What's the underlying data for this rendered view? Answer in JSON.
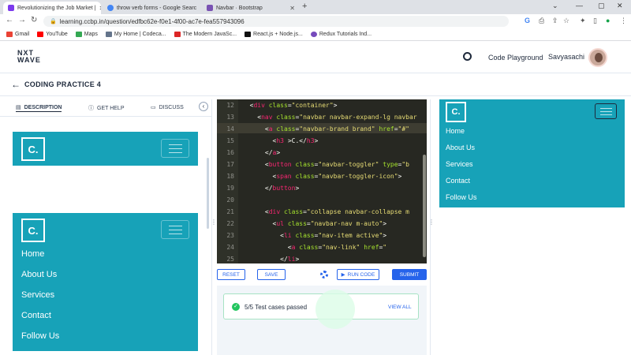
{
  "browser": {
    "tabs": [
      {
        "title": "Revolutionizing the Job Market | ",
        "active": true
      },
      {
        "title": "throw verb forms - Google Searc",
        "active": false
      },
      {
        "title": "Navbar · Bootstrap",
        "active": false
      }
    ],
    "url": "learning.ccbp.in/question/edfbc62e-f0e1-4f00-ac7e-fea557943096",
    "bookmarks": [
      "Gmail",
      "YouTube",
      "Maps",
      "My Home | Codeca...",
      "The Modern JavaSc...",
      "React.js + Node.js...",
      "Redux Tutorials Ind..."
    ]
  },
  "header": {
    "logo_line1": "NXT",
    "logo_line2": "WAVE",
    "playground": "Code Playground",
    "username": "Savyasachi"
  },
  "subheader": {
    "title": "CODING PRACTICE 4"
  },
  "left_tabs": {
    "description": "DESCRIPTION",
    "get_help": "GET HELP",
    "discuss": "DISCUSS"
  },
  "preview": {
    "brand": "C.",
    "links": [
      "Home",
      "About Us",
      "Services",
      "Contact",
      "Follow Us"
    ]
  },
  "editor": {
    "line_numbers": [
      "12",
      "13",
      "14",
      "15",
      "16",
      "17",
      "18",
      "19",
      "20",
      "21",
      "22",
      "23",
      "24",
      "25"
    ]
  },
  "actions": {
    "reset": "RESET",
    "save": "SAVE",
    "run": "RUN CODE",
    "submit": "SUBMIT"
  },
  "result": {
    "passed": "5/5 Test cases passed",
    "view_all": "VIEW ALL"
  },
  "colors": {
    "navbar": "#17a2b8",
    "accent": "#2563eb",
    "editor_bg": "#272822",
    "success": "#22c55e"
  }
}
